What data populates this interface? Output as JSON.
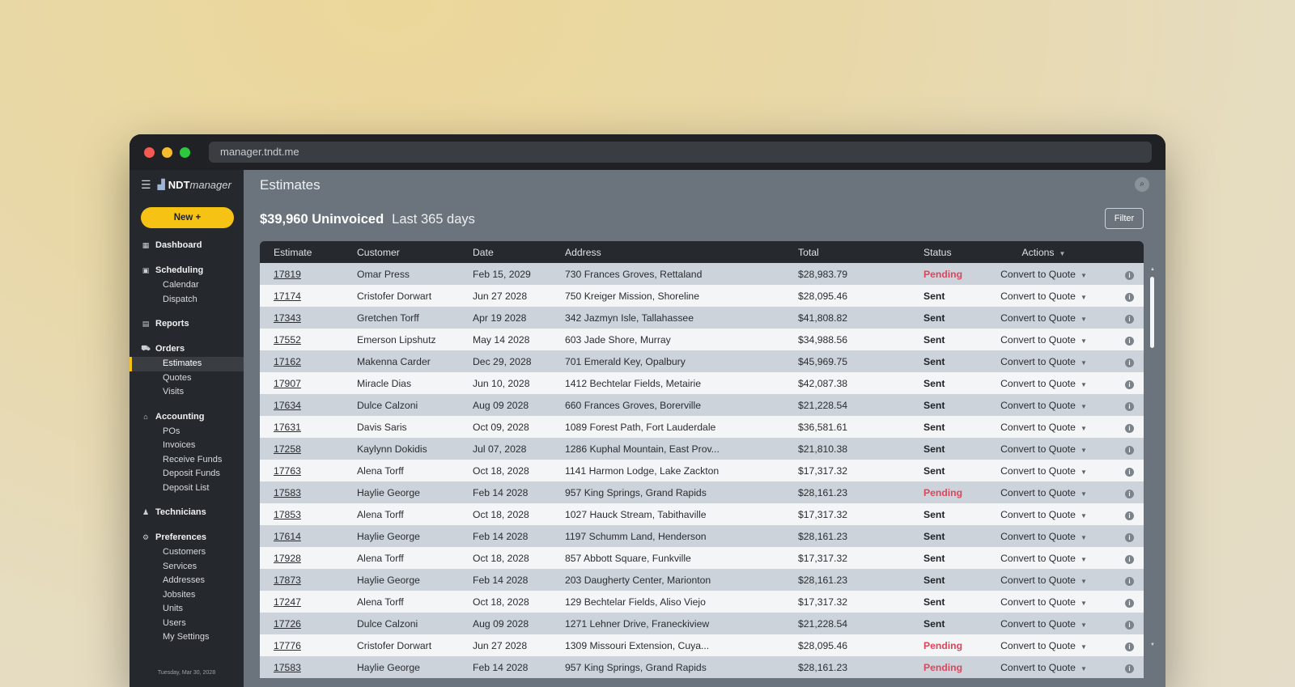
{
  "browser": {
    "url": "manager.tndt.me"
  },
  "brand": {
    "bold": "NDT",
    "italic": "manager"
  },
  "sidebar": {
    "new_button": "New +",
    "sections": [
      {
        "key": "dashboard",
        "label": "Dashboard",
        "icon": "dashboard-icon",
        "items": []
      },
      {
        "key": "scheduling",
        "label": "Scheduling",
        "icon": "calendar-icon",
        "items": [
          "Calendar",
          "Dispatch"
        ]
      },
      {
        "key": "reports",
        "label": "Reports",
        "icon": "document-icon",
        "items": []
      },
      {
        "key": "orders",
        "label": "Orders",
        "icon": "cart-icon",
        "items": [
          "Estimates",
          "Quotes",
          "Visits"
        ]
      },
      {
        "key": "accounting",
        "label": "Accounting",
        "icon": "bank-icon",
        "items": [
          "POs",
          "Invoices",
          "Receive Funds",
          "Deposit Funds",
          "Deposit List"
        ]
      },
      {
        "key": "technicians",
        "label": "Technicians",
        "icon": "people-icon",
        "items": []
      },
      {
        "key": "preferences",
        "label": "Preferences",
        "icon": "gear-icon",
        "items": [
          "Customers",
          "Services",
          "Addresses",
          "Jobsites",
          "Units",
          "Users",
          "My Settings"
        ]
      }
    ],
    "active_item": "Estimates",
    "date": "Tuesday, Mar 30, 2028"
  },
  "main": {
    "title": "Estimates",
    "summary_amount": "$39,960 Uninvoiced",
    "summary_period": "Last 365 days",
    "filter_label": "Filter"
  },
  "table": {
    "columns": [
      "Estimate",
      "Customer",
      "Date",
      "Address",
      "Total",
      "Status",
      "Actions"
    ],
    "action_label": "Convert to Quote",
    "rows": [
      [
        "17819",
        "Omar Press",
        "Feb 15, 2029",
        "730 Frances Groves, Rettaland",
        "$28,983.79",
        "Pending"
      ],
      [
        "17174",
        "Cristofer Dorwart",
        "Jun 27 2028",
        "750 Kreiger Mission, Shoreline",
        "$28,095.46",
        "Sent"
      ],
      [
        "17343",
        "Gretchen Torff",
        "Apr 19 2028",
        "342 Jazmyn Isle, Tallahassee",
        "$41,808.82",
        "Sent"
      ],
      [
        "17552",
        "Emerson Lipshutz",
        "May 14 2028",
        "603 Jade Shore, Murray",
        "$34,988.56",
        "Sent"
      ],
      [
        "17162",
        "Makenna Carder",
        "Dec 29, 2028",
        "701 Emerald Key, Opalbury",
        "$45,969.75",
        "Sent"
      ],
      [
        "17907",
        "Miracle Dias",
        "Jun 10, 2028",
        "1412 Bechtelar Fields, Metairie",
        "$42,087.38",
        "Sent"
      ],
      [
        "17634",
        "Dulce Calzoni",
        "Aug 09 2028",
        "660 Frances Groves, Borerville",
        "$21,228.54",
        "Sent"
      ],
      [
        "17631",
        "Davis Saris",
        "Oct 09, 2028",
        "1089 Forest Path, Fort Lauderdale",
        "$36,581.61",
        "Sent"
      ],
      [
        "17258",
        "Kaylynn Dokidis",
        "Jul 07, 2028",
        "1286 Kuphal Mountain, East Prov...",
        "$21,810.38",
        "Sent"
      ],
      [
        "17763",
        "Alena Torff",
        "Oct 18, 2028",
        "1141 Harmon Lodge, Lake Zackton",
        "$17,317.32",
        "Sent"
      ],
      [
        "17583",
        "Haylie George",
        "Feb 14 2028",
        "957 King Springs, Grand Rapids",
        "$28,161.23",
        "Pending"
      ],
      [
        "17853",
        "Alena Torff",
        "Oct 18, 2028",
        "1027 Hauck Stream, Tabithaville",
        "$17,317.32",
        "Sent"
      ],
      [
        "17614",
        "Haylie George",
        "Feb 14 2028",
        "1197 Schumm Land, Henderson",
        "$28,161.23",
        "Sent"
      ],
      [
        "17928",
        "Alena Torff",
        "Oct 18, 2028",
        "857 Abbott Square, Funkville",
        "$17,317.32",
        "Sent"
      ],
      [
        "17873",
        "Haylie George",
        "Feb 14 2028",
        "203 Daugherty Center, Marionton",
        "$28,161.23",
        "Sent"
      ],
      [
        "17247",
        "Alena Torff",
        "Oct 18, 2028",
        "129 Bechtelar Fields, Aliso Viejo",
        "$17,317.32",
        "Sent"
      ],
      [
        "17726",
        "Dulce Calzoni",
        "Aug 09 2028",
        "1271 Lehner Drive, Franeckiview",
        "$21,228.54",
        "Sent"
      ],
      [
        "17776",
        "Cristofer Dorwart",
        "Jun 27 2028",
        "1309 Missouri Extension, Cuya...",
        "$28,095.46",
        "Pending"
      ],
      [
        "17583",
        "Haylie George",
        "Feb 14 2028",
        "957 King Springs, Grand Rapids",
        "$28,161.23",
        "Pending"
      ]
    ]
  },
  "colors": {
    "accent": "#f6c315",
    "pending": "#e0445a"
  }
}
